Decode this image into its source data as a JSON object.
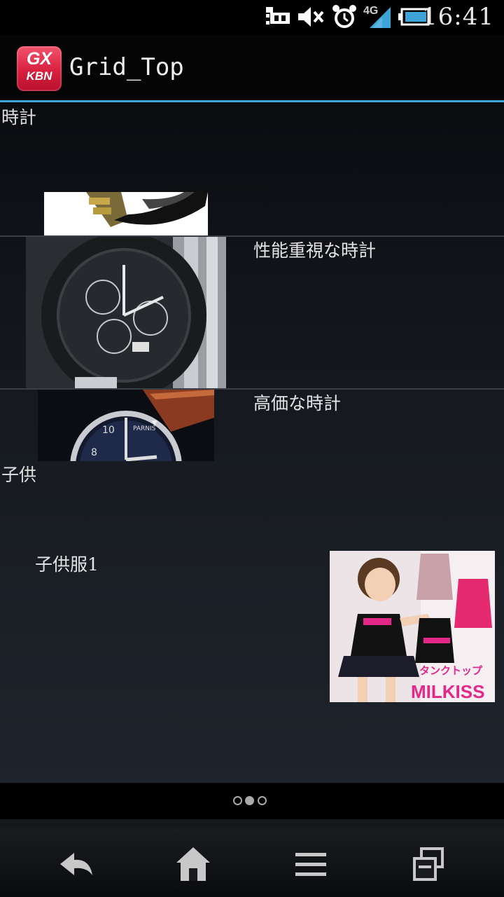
{
  "status_bar": {
    "time": "16:41",
    "network": "4G",
    "icons": [
      "usb-debug-icon",
      "mute-icon",
      "alarm-icon",
      "signal-icon",
      "battery-icon"
    ]
  },
  "action_bar": {
    "logo_line1": "GX",
    "logo_line2": "KBN",
    "title": "Grid_Top"
  },
  "sections": [
    {
      "header": "時計",
      "items": [
        {
          "label": "性能重視な時計"
        },
        {
          "label": "高価な時計"
        }
      ]
    },
    {
      "header": "子供",
      "items": [
        {
          "label": "子供服1"
        }
      ]
    }
  ],
  "product_image_text": {
    "tank_top": "タンクトップ",
    "brand": "MILKISS",
    "watch_brand": "PARNIS"
  },
  "pager": {
    "pages": 3,
    "active_index": 1
  },
  "nav_bar": [
    "back-icon",
    "home-icon",
    "menu-icon",
    "recent-apps-icon"
  ],
  "colors": {
    "accent": "#3ea3d8",
    "logo": "#e0304c"
  }
}
